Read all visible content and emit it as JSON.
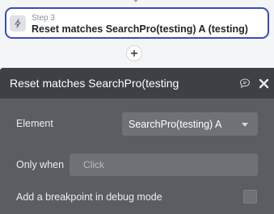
{
  "step": {
    "label": "Step 3",
    "title": "Reset matches SearchPro(testing) A (testing)",
    "icon": "lightning-icon"
  },
  "add_step": {
    "icon": "plus-icon"
  },
  "panel": {
    "title": "Reset matches SearchPro(testing",
    "comment_icon": "comment-icon",
    "close_icon": "close-icon",
    "element": {
      "label": "Element",
      "value": "SearchPro(testing) A"
    },
    "only_when": {
      "label": "Only when",
      "placeholder": "Click"
    },
    "breakpoint": {
      "label": "Add a breakpoint in debug mode",
      "checked": false
    }
  },
  "colors": {
    "accent": "#3b4bb7",
    "panel_bg": "#5a5d61",
    "panel_header": "#3d4044",
    "field_bg": "#6e7175"
  }
}
